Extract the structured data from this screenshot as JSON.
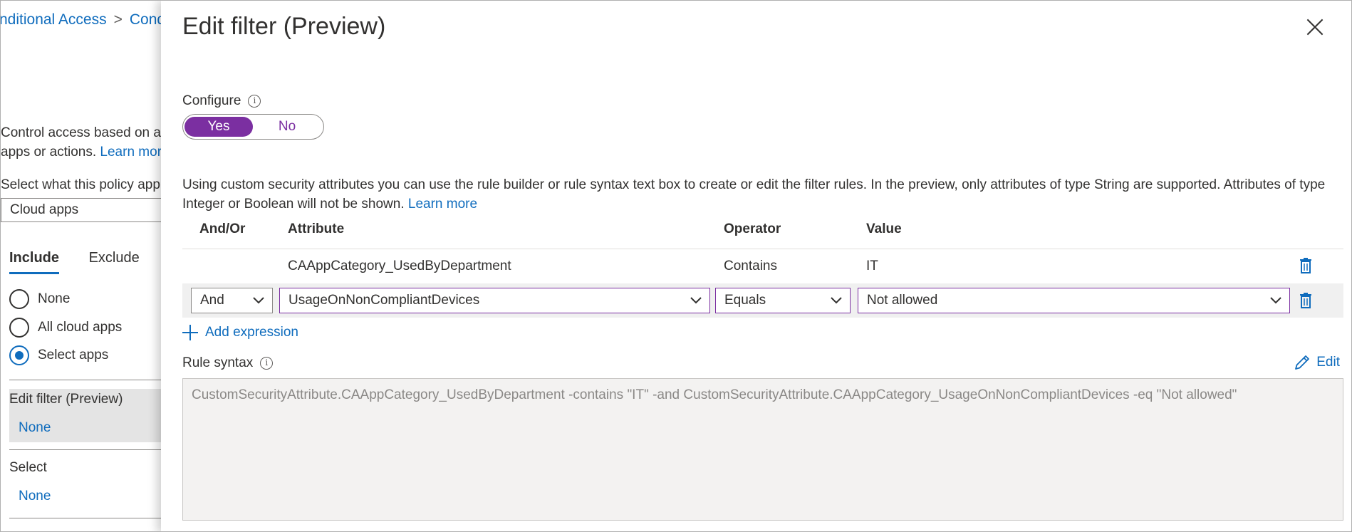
{
  "background": {
    "breadcrumb": [
      "nditional Access",
      "Cond"
    ],
    "breadcrumb_sep": ">",
    "description_line1": "Control access based on a",
    "description_line2": "apps or actions.",
    "learn_more": "Learn mor",
    "select_label": "Select what this policy app",
    "selected_option": "Cloud apps",
    "tabs": {
      "include": "Include",
      "exclude": "Exclude"
    },
    "radio_options": [
      {
        "label": "None",
        "selected": false
      },
      {
        "label": "All cloud apps",
        "selected": false
      },
      {
        "label": "Select apps",
        "selected": true
      }
    ],
    "edit_filter": {
      "title": "Edit filter (Preview)",
      "value": "None"
    },
    "select_section": {
      "title": "Select",
      "value": "None"
    }
  },
  "panel": {
    "title": "Edit filter (Preview)",
    "configure_label": "Configure",
    "toggle": {
      "yes": "Yes",
      "no": "No",
      "selected": "Yes"
    },
    "description": "Using custom security attributes you can use the rule builder or rule syntax text box to create or edit the filter rules. In the preview, only attributes of type String are supported. Attributes of type Integer or Boolean will not be shown.",
    "learn_more": "Learn more",
    "table": {
      "headers": {
        "andor": "And/Or",
        "attribute": "Attribute",
        "operator": "Operator",
        "value": "Value"
      },
      "rows": [
        {
          "andor": "",
          "attribute": "CAAppCategory_UsedByDepartment",
          "operator": "Contains",
          "value": "IT"
        },
        {
          "andor": "And",
          "attribute": "UsageOnNonCompliantDevices",
          "operator": "Equals",
          "value": "Not allowed"
        }
      ]
    },
    "add_expression": "Add expression",
    "rule_syntax_label": "Rule syntax",
    "edit_label": "Edit",
    "rule_syntax": "CustomSecurityAttribute.CAAppCategory_UsedByDepartment -contains \"IT\" -and CustomSecurityAttribute.CAAppCategory_UsageOnNonCompliantDevices -eq \"Not allowed\""
  },
  "colors": {
    "accent": "#0f6cbd",
    "toggle": "#7b2fa1",
    "text": "#323130"
  }
}
